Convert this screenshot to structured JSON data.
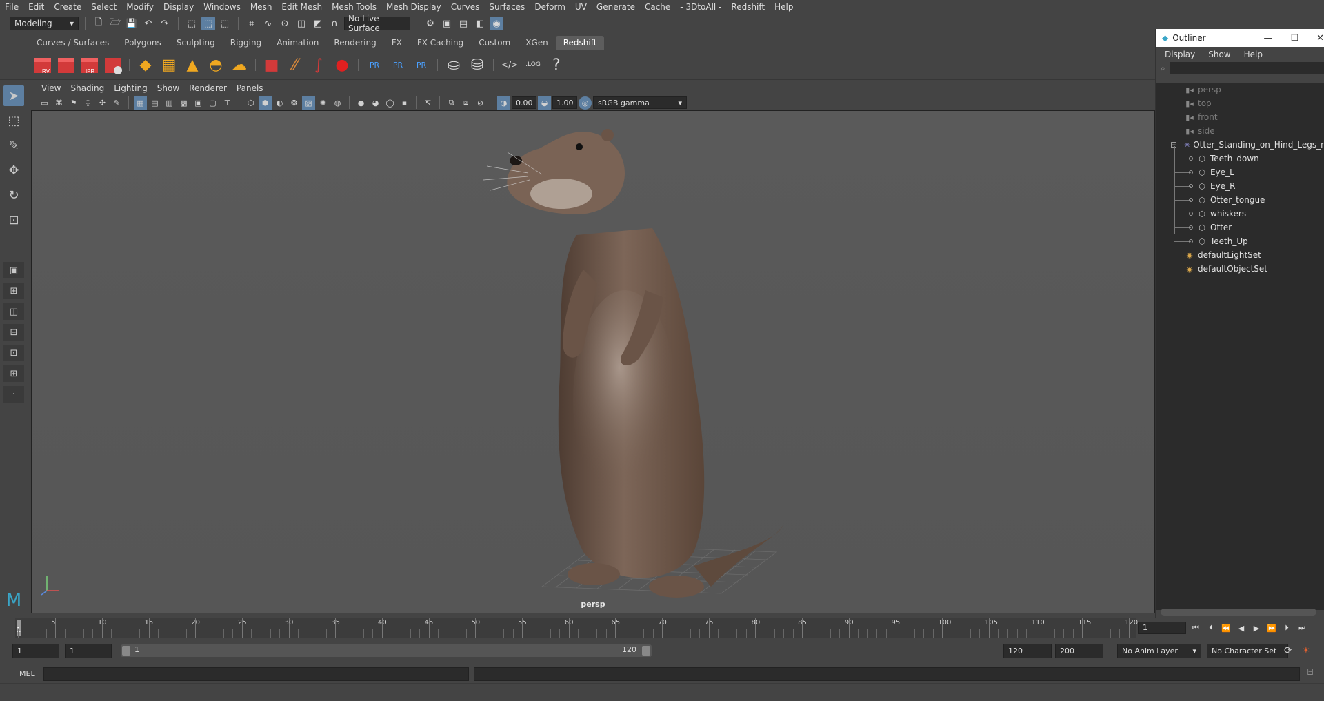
{
  "menubar": [
    "File",
    "Edit",
    "Create",
    "Select",
    "Modify",
    "Display",
    "Windows",
    "Mesh",
    "Edit Mesh",
    "Mesh Tools",
    "Mesh Display",
    "Curves",
    "Surfaces",
    "Deform",
    "UV",
    "Generate",
    "Cache",
    "- 3DtoAll -",
    "Redshift",
    "Help"
  ],
  "statusline": {
    "mode": "Modeling",
    "live_surface": "No Live Surface"
  },
  "shelf": {
    "tabs": [
      "Curves / Surfaces",
      "Polygons",
      "Sculpting",
      "Rigging",
      "Animation",
      "Rendering",
      "FX",
      "FX Caching",
      "Custom",
      "XGen",
      "Redshift"
    ],
    "active_tab": "Redshift",
    "icon_labels": [
      "RV",
      "IPR",
      "PR",
      "PR",
      "PR",
      ".LOG",
      "?"
    ]
  },
  "panel": {
    "menu": [
      "View",
      "Shading",
      "Lighting",
      "Show",
      "Renderer",
      "Panels"
    ],
    "exposure": "0.00",
    "gamma": "1.00",
    "color_space": "sRGB gamma",
    "camera_label": "persp"
  },
  "outliner": {
    "title": "Outliner",
    "menu": [
      "Display",
      "Show",
      "Help"
    ],
    "items": [
      {
        "label": "persp",
        "icon": "camera-icon",
        "dim": true,
        "indent": 1
      },
      {
        "label": "top",
        "icon": "camera-icon",
        "dim": true,
        "indent": 1
      },
      {
        "label": "front",
        "icon": "camera-icon",
        "dim": true,
        "indent": 1
      },
      {
        "label": "side",
        "icon": "camera-icon",
        "dim": true,
        "indent": 1
      },
      {
        "label": "Otter_Standing_on_Hind_Legs_ncl",
        "icon": "group-icon",
        "dim": false,
        "indent": 1
      },
      {
        "label": "Teeth_down",
        "icon": "mesh-icon",
        "dim": false,
        "indent": 2
      },
      {
        "label": "Eye_L",
        "icon": "mesh-icon",
        "dim": false,
        "indent": 2
      },
      {
        "label": "Eye_R",
        "icon": "mesh-icon",
        "dim": false,
        "indent": 2
      },
      {
        "label": "Otter_tongue",
        "icon": "mesh-icon",
        "dim": false,
        "indent": 2
      },
      {
        "label": "whiskers",
        "icon": "mesh-icon",
        "dim": false,
        "indent": 2
      },
      {
        "label": "Otter",
        "icon": "mesh-icon",
        "dim": false,
        "indent": 2
      },
      {
        "label": "Teeth_Up",
        "icon": "mesh-icon",
        "dim": false,
        "indent": 2
      },
      {
        "label": "defaultLightSet",
        "icon": "set-icon",
        "dim": false,
        "indent": 1
      },
      {
        "label": "defaultObjectSet",
        "icon": "set-icon",
        "dim": false,
        "indent": 1
      }
    ]
  },
  "timeline": {
    "ticks": [
      5,
      10,
      15,
      20,
      25,
      30,
      35,
      40,
      45,
      50,
      55,
      60,
      65,
      70,
      75,
      80,
      85,
      90,
      95,
      100,
      105,
      110,
      115,
      120
    ],
    "current_marker": "1",
    "current_frame": "1",
    "range_min": 1,
    "range_max": 120
  },
  "range": {
    "start": "1",
    "playback_start": "1",
    "slider_start": "1",
    "slider_end": "120",
    "playback_end": "120",
    "end": "200",
    "anim_layer": "No Anim Layer",
    "character_set": "No Character Set"
  },
  "cmdline": {
    "label": "MEL"
  },
  "colors": {
    "accent": "#5d7fa1",
    "viewport": "#585858",
    "panel": "#444444",
    "field": "#2b2b2b"
  }
}
